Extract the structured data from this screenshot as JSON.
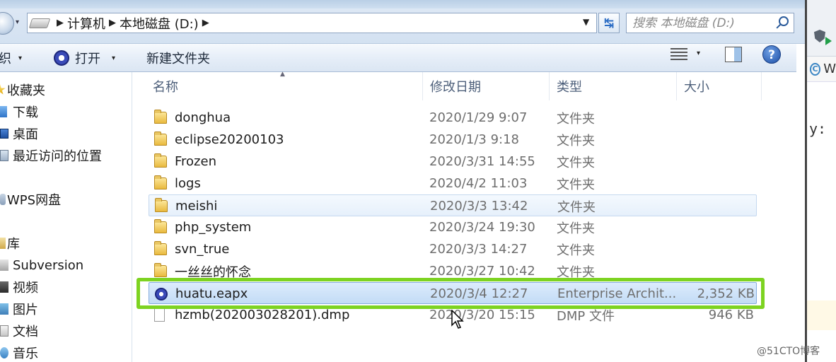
{
  "address": {
    "breadcrumbs": [
      "计算机",
      "本地磁盘 (D:)"
    ],
    "search_placeholder": "搜索 本地磁盘 (D:)"
  },
  "toolbar": {
    "organize_label": "织",
    "open_label": "打开",
    "new_folder_label": "新建文件夹"
  },
  "sidebar": {
    "items": [
      {
        "label": "收藏夹",
        "icon": "star-icon"
      },
      {
        "label": "下载",
        "icon": "download-icon"
      },
      {
        "label": "桌面",
        "icon": "desktop-icon"
      },
      {
        "label": "最近访问的位置",
        "icon": "recent-places-icon"
      },
      {
        "label": "WPS网盘",
        "icon": "wps-cloud-icon"
      },
      {
        "label": "库",
        "icon": "library-icon"
      },
      {
        "label": "Subversion",
        "icon": "subversion-icon"
      },
      {
        "label": "视频",
        "icon": "video-icon"
      },
      {
        "label": "图片",
        "icon": "pictures-icon"
      },
      {
        "label": "文档",
        "icon": "documents-icon"
      },
      {
        "label": "音乐",
        "icon": "music-icon"
      }
    ]
  },
  "columns": {
    "name": "名称",
    "modified": "修改日期",
    "type": "类型",
    "size": "大小"
  },
  "files": [
    {
      "name": "donghua",
      "modified": "2020/1/29 9:07",
      "type": "文件夹",
      "size": "",
      "icon": "folder-icon"
    },
    {
      "name": "eclipse20200103",
      "modified": "2020/1/3 9:18",
      "type": "文件夹",
      "size": "",
      "icon": "folder-icon"
    },
    {
      "name": "Frozen",
      "modified": "2020/3/31 14:55",
      "type": "文件夹",
      "size": "",
      "icon": "folder-icon"
    },
    {
      "name": "logs",
      "modified": "2020/4/2 11:03",
      "type": "文件夹",
      "size": "",
      "icon": "folder-icon"
    },
    {
      "name": "meishi",
      "modified": "2020/3/3 13:42",
      "type": "文件夹",
      "size": "",
      "icon": "folder-icon"
    },
    {
      "name": "php_system",
      "modified": "2020/3/24 19:30",
      "type": "文件夹",
      "size": "",
      "icon": "folder-icon"
    },
    {
      "name": "svn_true",
      "modified": "2020/3/3 14:27",
      "type": "文件夹",
      "size": "",
      "icon": "folder-icon"
    },
    {
      "name": "一丝丝的怀念",
      "modified": "2020/3/27 10:42",
      "type": "文件夹",
      "size": "",
      "icon": "folder-icon"
    },
    {
      "name": "huatu.eapx",
      "modified": "2020/3/4 12:27",
      "type": "Enterprise Archit...",
      "size": "2,352 KB",
      "icon": "enterprise-architect-icon"
    },
    {
      "name": "hzmb(202003028201).dmp",
      "modified": "2020/3/20 15:15",
      "type": "DMP 文件",
      "size": "946 KB",
      "icon": "file-icon"
    }
  ],
  "right_window": {
    "tab_text": "W",
    "code_text_key": "y: ",
    "code_text_quote": "\"-"
  },
  "watermark": "@51CTO博客",
  "colors": {
    "highlight": "#7dd321",
    "selection": "#c3dcf6"
  }
}
